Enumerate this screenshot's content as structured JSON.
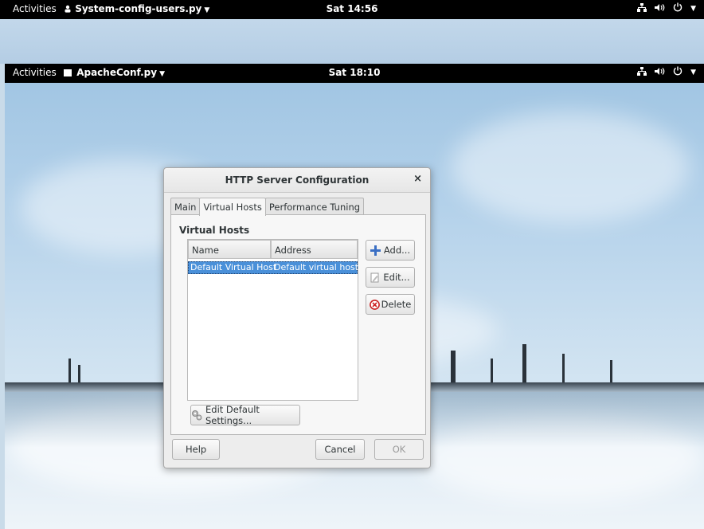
{
  "outer_bar": {
    "activities": "Activities",
    "app_name": "System-config-users.py",
    "app_icon": "user-group-icon",
    "clock": "Sat 14:56",
    "tray_icons": [
      "network-icon",
      "volume-icon",
      "power-icon",
      "chevron-down-icon"
    ]
  },
  "inner_bar": {
    "activities": "Activities",
    "app_name": "ApacheConf.py",
    "app_icon": "window-icon",
    "clock": "Sat 18:10",
    "tray_icons": [
      "network-icon",
      "volume-icon",
      "power-icon",
      "chevron-down-icon"
    ]
  },
  "dialog": {
    "title": "HTTP Server Configuration",
    "close": "×",
    "tabs": [
      {
        "label": "Main"
      },
      {
        "label": "Virtual Hosts",
        "active": true
      },
      {
        "label": "Performance Tuning"
      }
    ],
    "section_title": "Virtual Hosts",
    "columns": [
      "Name",
      "Address"
    ],
    "rows": [
      {
        "name": "Default Virtual Host",
        "address": "Default virtual host",
        "selected": true
      }
    ],
    "buttons": {
      "add": "Add...",
      "edit": "Edit...",
      "delete": "Delete",
      "edit_default": "Edit Default Settings...",
      "help": "Help",
      "cancel": "Cancel",
      "ok": "OK"
    }
  },
  "colors": {
    "selection": "#4a90d9",
    "topbar": "#000000",
    "delete_icon": "#cc2222",
    "add_icon": "#3a6fc4"
  }
}
